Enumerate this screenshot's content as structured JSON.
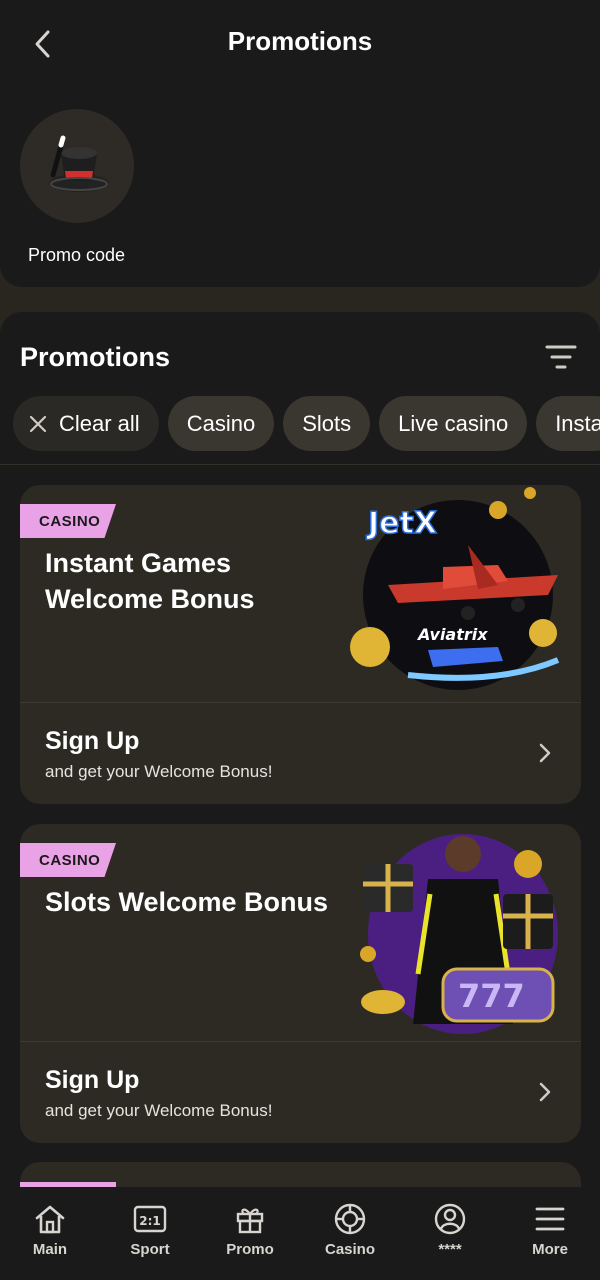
{
  "header": {
    "title": "Promotions"
  },
  "promo_code": {
    "label": "Promo code"
  },
  "promotions": {
    "section_title": "Promotions",
    "chips": [
      {
        "label": "Clear all"
      },
      {
        "label": "Casino"
      },
      {
        "label": "Slots"
      },
      {
        "label": "Live casino"
      },
      {
        "label": "Insta"
      }
    ],
    "cards": [
      {
        "badge": "CASINO",
        "title": "Instant Games Welcome Bonus",
        "image_text": [
          "JetX",
          "Aviatrix"
        ],
        "cta_title": "Sign Up",
        "cta_subtitle": "and get your Welcome Bonus!"
      },
      {
        "badge": "CASINO",
        "title": "Slots Welcome Bonus",
        "image_text": [
          "777"
        ],
        "cta_title": "Sign Up",
        "cta_subtitle": "and get your Welcome Bonus!"
      }
    ]
  },
  "nav": [
    {
      "label": "Main",
      "icon": "home-icon"
    },
    {
      "label": "Sport",
      "icon": "scoreboard-icon"
    },
    {
      "label": "Promo",
      "icon": "gift-icon"
    },
    {
      "label": "Casino",
      "icon": "chip-icon"
    },
    {
      "label": "****",
      "icon": "user-icon"
    },
    {
      "label": "More",
      "icon": "menu-icon"
    }
  ],
  "colors": {
    "badge": "#e9a2e6",
    "background": "#1a1a1a",
    "card": "#2d2a24",
    "chip": "#3a3630"
  }
}
